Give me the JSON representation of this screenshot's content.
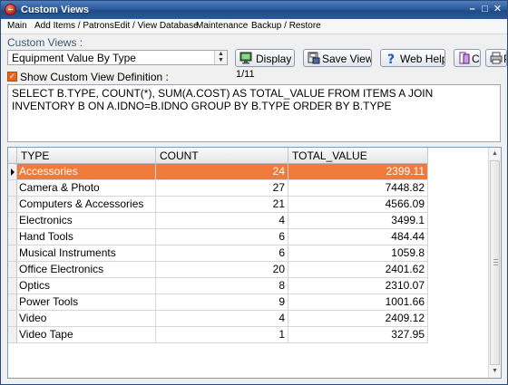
{
  "window": {
    "title": "Custom Views"
  },
  "title_controls": {
    "minimize": "–",
    "maximize": "□",
    "close": "✕"
  },
  "menu": [
    {
      "label": "Main"
    },
    {
      "label": "Add Items / Patrons"
    },
    {
      "label": "Edit / View Database"
    },
    {
      "label": "Maintenance"
    },
    {
      "label": "Backup / Restore"
    }
  ],
  "custom_views_label": "Custom Views :",
  "view_select": {
    "value": "Equipment Value By Type",
    "arrow": "▲▼"
  },
  "toolbar": {
    "display": {
      "label": "Display",
      "icon": "monitor-icon"
    },
    "save_view": {
      "label": "Save View",
      "icon": "save-icon"
    },
    "web_help": {
      "label": "Web Help",
      "icon": "help-icon"
    },
    "copy": {
      "label": "C",
      "icon": "copy-icon"
    },
    "print": {
      "label": "P",
      "icon": "print-icon"
    }
  },
  "page_indicator": "1/11",
  "show_definition": {
    "label": "Show Custom View Definition :",
    "checked": true,
    "mark": "✓"
  },
  "sql_definition": "SELECT B.TYPE, COUNT(*), SUM(A.COST) AS TOTAL_VALUE FROM ITEMS A JOIN INVENTORY B ON A.IDNO=B.IDNO GROUP BY B.TYPE ORDER BY B.TYPE",
  "grid": {
    "columns": [
      "TYPE",
      "COUNT",
      "TOTAL_VALUE"
    ],
    "selected_row": 0,
    "rows": [
      [
        "Accessories",
        "24",
        "2399.11"
      ],
      [
        "Camera & Photo",
        "27",
        "7448.82"
      ],
      [
        "Computers & Accessories",
        "21",
        "4566.09"
      ],
      [
        "Electronics",
        "4",
        "3499.1"
      ],
      [
        "Hand Tools",
        "6",
        "484.44"
      ],
      [
        "Musical Instruments",
        "6",
        "1059.8"
      ],
      [
        "Office Electronics",
        "20",
        "2401.62"
      ],
      [
        "Optics",
        "8",
        "2310.07"
      ],
      [
        "Power Tools",
        "9",
        "1001.66"
      ],
      [
        "Video",
        "4",
        "2409.12"
      ],
      [
        "Video Tape",
        "1",
        "327.95"
      ]
    ]
  },
  "scrollbar": {
    "up": "▲",
    "down": "▼"
  },
  "colors": {
    "titlebar": "#2d5a9a",
    "selection": "#f07a3a",
    "checkbox": "#e8641a",
    "label_text": "#3c5a78"
  }
}
